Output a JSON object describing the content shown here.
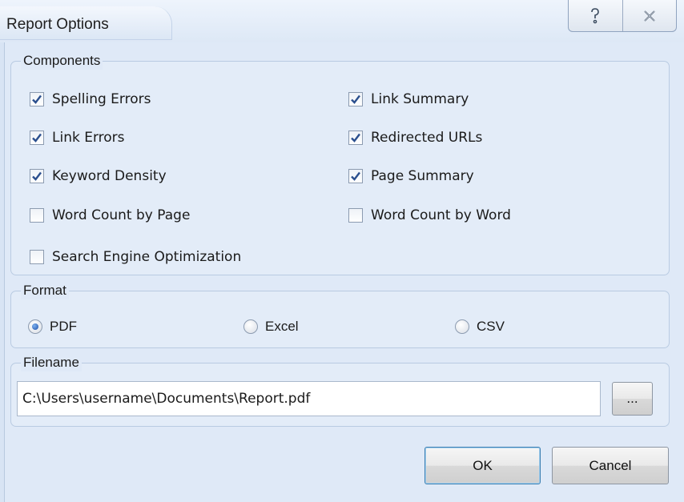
{
  "window": {
    "title": "Report Options",
    "help_glyph": "?",
    "close_glyph": "✕"
  },
  "components": {
    "legend": "Components",
    "items": [
      {
        "label": "Spelling Errors",
        "checked": true
      },
      {
        "label": "Link Summary",
        "checked": true
      },
      {
        "label": "Link Errors",
        "checked": true
      },
      {
        "label": "Redirected URLs",
        "checked": true
      },
      {
        "label": "Keyword Density",
        "checked": true
      },
      {
        "label": "Page Summary",
        "checked": true
      },
      {
        "label": "Word Count by Page",
        "checked": false
      },
      {
        "label": "Word Count by Word",
        "checked": false
      },
      {
        "label": "Search Engine Optimization",
        "checked": false
      }
    ]
  },
  "format": {
    "legend": "Format",
    "options": [
      {
        "label": "PDF",
        "selected": true
      },
      {
        "label": "Excel",
        "selected": false
      },
      {
        "label": "CSV",
        "selected": false
      }
    ]
  },
  "filename": {
    "legend": "Filename",
    "value": "C:\\Users\\username\\Documents\\Report.pdf",
    "browse_label": "..."
  },
  "buttons": {
    "ok_label": "OK",
    "cancel_label": "Cancel"
  },
  "colors": {
    "accent": "#2a5fb8",
    "check": "#2b4f8e"
  }
}
